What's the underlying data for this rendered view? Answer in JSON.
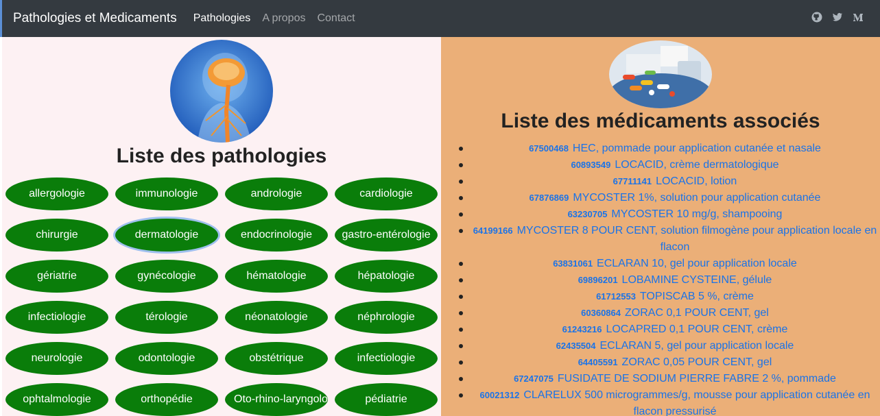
{
  "navbar": {
    "brand": "Pathologies et Medicaments",
    "links": [
      "Pathologies",
      "A propos",
      "Contact"
    ],
    "icons": [
      "github-icon",
      "twitter-icon",
      "medium-icon"
    ]
  },
  "left": {
    "title": "Liste des pathologies",
    "pathologies": [
      "allergologie",
      "immunologie",
      "andrologie",
      "cardiologie",
      "chirurgie",
      "dermatologie",
      "endocrinologie",
      "gastro-entérologie",
      "gériatrie",
      "gynécologie",
      "hématologie",
      "hépatologie",
      "infectiologie",
      "térologie",
      "néonatologie",
      "néphrologie",
      "neurologie",
      "odontologie",
      "obstétrique",
      "infectiologie",
      "ophtalmologie",
      "orthopédie",
      "Oto-rhino-laryngologie",
      "pédiatrie"
    ],
    "selected": "dermatologie"
  },
  "right": {
    "title": "Liste des médicaments associés",
    "medicaments": [
      {
        "code": "67500468",
        "name": "HEC, pommade pour application cutanée et nasale"
      },
      {
        "code": "60893549",
        "name": "LOCACID, crème dermatologique"
      },
      {
        "code": "67711141",
        "name": "LOCACID, lotion"
      },
      {
        "code": "67876869",
        "name": "MYCOSTER 1%, solution pour application cutanée"
      },
      {
        "code": "63230705",
        "name": "MYCOSTER 10 mg/g, shampooing"
      },
      {
        "code": "64199166",
        "name": "MYCOSTER 8 POUR CENT, solution filmogène pour application locale en flacon"
      },
      {
        "code": "63831061",
        "name": "ECLARAN 10, gel pour application locale"
      },
      {
        "code": "69896201",
        "name": "LOBAMINE CYSTEINE, gélule"
      },
      {
        "code": "61712553",
        "name": "TOPISCAB 5 %, crème"
      },
      {
        "code": "60360864",
        "name": "ZORAC 0,1 POUR CENT, gel"
      },
      {
        "code": "61243216",
        "name": "LOCAPRED 0,1 POUR CENT, crème"
      },
      {
        "code": "62435504",
        "name": "ECLARAN 5, gel pour application locale"
      },
      {
        "code": "64405591",
        "name": "ZORAC 0,05 POUR CENT, gel"
      },
      {
        "code": "67247075",
        "name": "FUSIDATE DE SODIUM PIERRE FABRE 2 %, pommade"
      },
      {
        "code": "60021312",
        "name": "CLARELUX 500 microgrammes/g, mousse pour application cutanée en flacon pressurisé"
      }
    ]
  }
}
